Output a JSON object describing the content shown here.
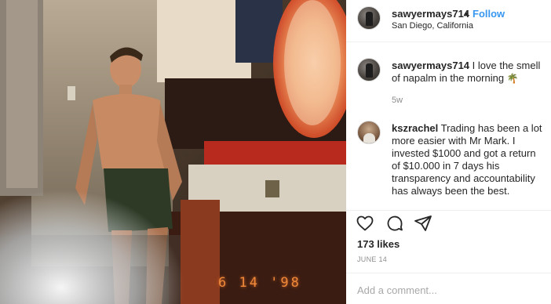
{
  "post": {
    "photo_stamp": "6 14 '98"
  },
  "header": {
    "username": "sawyermays714",
    "separator": "•",
    "follow_label": "Follow",
    "location": "San Diego, California"
  },
  "caption": {
    "username": "sawyermays714",
    "text": "I love the smell of napalm in the morning",
    "emoji": "🌴",
    "age": "5w"
  },
  "comments": [
    {
      "username": "kszrachel",
      "text": "Trading has been a lot more easier with Mr Mark. I invested $1000 and got a return of $10.000 in 7 days his transparency and accountability has always been the best."
    }
  ],
  "actions": {
    "like_icon": "heart-icon",
    "comment_icon": "comment-icon",
    "share_icon": "share-icon"
  },
  "likes": "173 likes",
  "date": "JUNE 14",
  "add_comment": {
    "placeholder": "Add a comment..."
  },
  "colors": {
    "accent": "#3897f0",
    "text": "#262626",
    "muted": "#8e8e8e",
    "border": "#efefef"
  }
}
